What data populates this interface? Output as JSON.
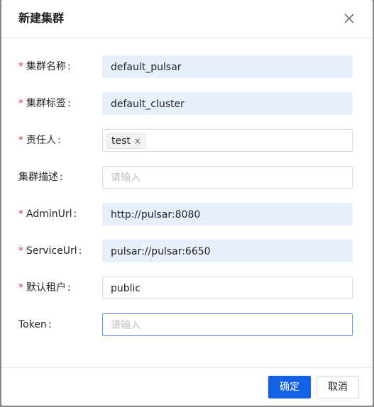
{
  "dialog": {
    "title": "新建集群",
    "close_icon": "close-icon"
  },
  "form": {
    "cluster_name": {
      "required": "*",
      "label": "集群名称",
      "colon": ":",
      "value": "default_pulsar"
    },
    "cluster_tag": {
      "required": "*",
      "label": "集群标签",
      "colon": ":",
      "value": "default_cluster"
    },
    "owner": {
      "required": "*",
      "label": "责任人",
      "colon": ":",
      "tag": "test",
      "tag_close": "×"
    },
    "description": {
      "label": "集群描述",
      "colon": ":",
      "placeholder": "请输入"
    },
    "admin_url": {
      "required": "*",
      "label": "AdminUrl",
      "colon": ":",
      "value": "http://pulsar:8080"
    },
    "service_url": {
      "required": "*",
      "label": "ServiceUrl",
      "colon": ":",
      "value": "pulsar://pulsar:6650"
    },
    "default_tenant": {
      "required": "*",
      "label": "默认租户",
      "colon": ":",
      "value": "public"
    },
    "token": {
      "label": "Token",
      "colon": ":",
      "placeholder": "请输入"
    }
  },
  "footer": {
    "ok_label": "确定",
    "cancel_label": "取消"
  },
  "colors": {
    "primary": "#1261e6",
    "required": "#e33b3b",
    "filled_bg": "#e8effd"
  }
}
